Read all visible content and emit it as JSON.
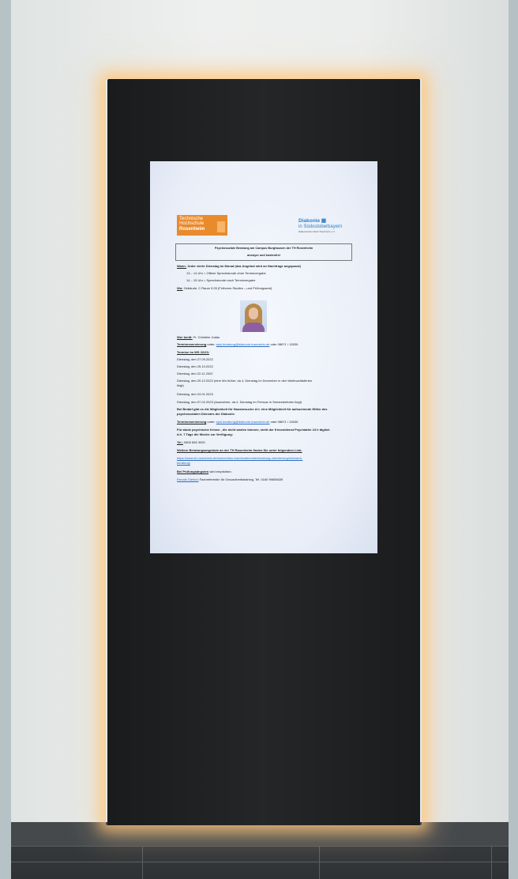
{
  "scene": {
    "description_alt": ""
  },
  "logos": {
    "th_line1": "Technische",
    "th_line2": "Hochschule",
    "th_line3": "Rosenheim",
    "diakonie_line1": "Diakonie",
    "diakonie_line2": "in Südostoberbayern",
    "diakonie_line3": "Diakonisches Werk Traunstein e.V."
  },
  "doc": {
    "title": "Psychosoziale Beratung am Campus Burghausen der TH Rosenheim",
    "subtitle": "anonym und kostenfrei",
    "when_label": "Wann:",
    "when_text": " Jeder vierte Dienstag im Monat (das Angebot wird an Nachfrage angepasst)",
    "slot1": "13 – 14 Uhr = Offene Sprechstunde ohne Terminvergabe",
    "slot2": "14 – 15 Uhr = Sprechstunde nach Terminvergabe",
    "where_label": "Wo:",
    "where_text": " Gebäude, C Raum 3.05 (Früheres Studien – und Prüfungsamt)",
    "who_label": "Wer berät:",
    "who_text": " Fr. Christine Judas",
    "booking_label": "Terminreservierung",
    "booking_text": " unter: ",
    "booking_email": "epsi.beratung@diakonie-traunstein.de",
    "booking_phone": " oder 08671 / 12630.",
    "dates_label": "Termine im WS 22/23:",
    "dates": [
      "Dienstag, den 27.09.2022",
      "Dienstag, den 25.10.2022",
      "Dienstag, den 22.11.2022",
      "Dienstag, den 20.12.2022 (eine Wo früher, da 4. Dienstag im Dezember in den Weihnachtsferien",
      "liegt)",
      "Dienstag, den 24.01.2023",
      "Dienstag, den 07.02.2023 (Ausnahme, da 4. Dienstag im Februar in Semesterferien liegt)"
    ],
    "need_line1": "Bei Bedarf gibt es die Möglichkeit für Hausbesuche d.h. eine Möglichkeit für aufsuchende Hilfen des",
    "need_line2": "psychosozialen Dienstes der Diakonie.",
    "booking2_label": "Terminreservierung",
    "booking2_text": " unter: ",
    "booking2_email": "epsi.beratung@diakonie-traunstein.de",
    "booking2_phone": " oder 08671 / 12630.",
    "crisis_line1": "Für akute psychische Krisen , die nicht warten können, steht der Krisendienst Psychiatrie 24 h täglich",
    "crisis_line2": "d.h. 7 Tage die Woche zur Verfügung:",
    "tel_label": "Tel.:",
    "tel_text": " 0800 655 3000",
    "more_label": "Weitere Beratungsangebote an der TH Rosenheim finden Sie unter folgendem Link:",
    "more_link1": "https://www.th-rosenheim.de/home/infos-fuer/studierende/beratung-orientierung/netzwerk-",
    "more_link2": "beratung/",
    "exam_label": "Bei Prüfungsängsten",
    "exam_text": " wird empfohlen:",
    "exam_contact_name": "Renate Dietrich",
    "exam_contact_text": " Fachreferentin für Gesundheitstraining, Tel. 0160 99655639"
  }
}
